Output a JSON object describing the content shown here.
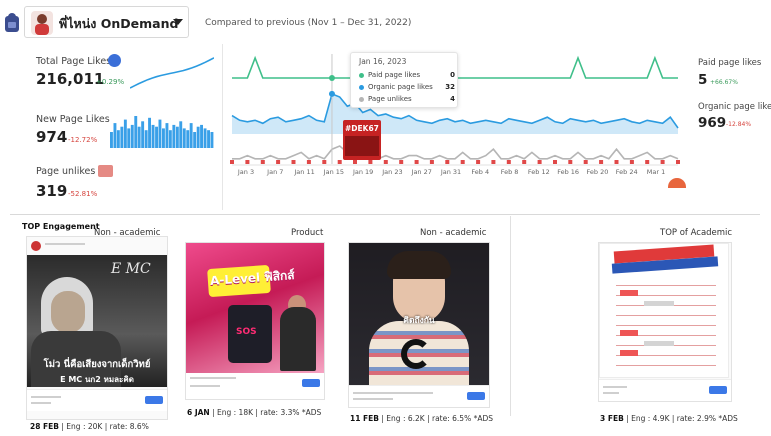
{
  "header": {
    "page_name": "พี่ไหน่ง OnDemand",
    "compare_text": "Compared to previous (Nov 1 – Dec 31, 2022)"
  },
  "kpis": {
    "total_page_likes": {
      "label": "Total Page Likes",
      "value": "216,011",
      "delta": "+0.29%"
    },
    "new_page_likes": {
      "label": "New Page Likes",
      "value": "974",
      "delta": "-12.72%"
    },
    "page_unlikes": {
      "label": "Page unlikes",
      "value": "319",
      "delta": "-52.81%"
    }
  },
  "right_kpis": {
    "paid_page_likes": {
      "label": "Paid page likes",
      "value": "5",
      "delta": "+66.67%"
    },
    "organic_page_likes": {
      "label": "Organic page likes",
      "value": "969",
      "delta": "-12.84%"
    }
  },
  "tooltip": {
    "date": "Jan 16, 2023",
    "rows": [
      {
        "label": "Paid page likes",
        "value": "0",
        "color": "#3fbf8a"
      },
      {
        "label": "Organic page likes",
        "value": "32",
        "color": "#2b9be0"
      },
      {
        "label": "Page unlikes",
        "value": "4",
        "color": "#b5b5b5"
      }
    ]
  },
  "red_badge_text": "#DEK67",
  "chart_data": {
    "type": "line",
    "x_tick_labels": [
      "Jan 3",
      "Jan 7",
      "Jan 11",
      "Jan 15",
      "Jan 19",
      "Jan 23",
      "Jan 27",
      "Jan 31",
      "Feb 4",
      "Feb 8",
      "Feb 12",
      "Feb 16",
      "Feb 20",
      "Feb 24",
      "Mar 1"
    ],
    "series": [
      {
        "name": "Paid page likes",
        "color": "#3fbf8a",
        "values": [
          0,
          0,
          0,
          1,
          0,
          0,
          0,
          0,
          0,
          0,
          0,
          0,
          0,
          0,
          0,
          0,
          0,
          0,
          0,
          0,
          0,
          0,
          0,
          0,
          0,
          0,
          0,
          0,
          0,
          0,
          0,
          0,
          0,
          0,
          0,
          0,
          0,
          0,
          0,
          0,
          0,
          0,
          0,
          0,
          0,
          1,
          0,
          0,
          0,
          0,
          0,
          0,
          0,
          0,
          0,
          1,
          0,
          0,
          0
        ]
      },
      {
        "name": "Organic page likes",
        "color": "#2b9be0",
        "values": [
          18,
          15,
          14,
          15,
          13,
          16,
          17,
          14,
          15,
          16,
          18,
          15,
          14,
          32,
          30,
          24,
          26,
          20,
          22,
          18,
          19,
          17,
          16,
          18,
          15,
          14,
          13,
          15,
          16,
          14,
          15,
          13,
          14,
          15,
          14,
          13,
          16,
          15,
          14,
          13,
          15,
          17,
          14,
          13,
          16,
          15,
          14,
          15,
          13,
          14,
          15,
          16,
          14,
          13,
          15,
          14,
          13,
          17,
          10
        ]
      },
      {
        "name": "Page unlikes",
        "color": "#b5b5b5",
        "values": [
          1,
          1,
          2,
          1,
          1,
          2,
          1,
          1,
          2,
          3,
          1,
          2,
          1,
          4,
          5,
          3,
          1,
          2,
          1,
          1,
          2,
          1,
          1,
          2,
          2,
          1,
          1,
          2,
          1,
          1,
          3,
          1,
          1,
          2,
          4,
          1,
          1,
          2,
          1,
          3,
          1,
          1,
          2,
          1,
          1,
          3,
          1,
          1,
          2,
          1,
          4,
          1,
          1,
          2,
          3,
          1,
          1,
          2,
          1
        ]
      }
    ],
    "sparklines": {
      "total_page_likes": [
        1,
        2,
        3,
        4,
        5,
        6,
        7,
        8,
        9,
        10,
        11,
        12,
        13,
        14,
        15,
        16,
        17,
        18,
        19,
        20
      ],
      "new_page_likes": [
        9,
        14,
        10,
        12,
        16,
        11,
        13,
        18,
        12,
        15,
        10,
        17,
        13,
        12,
        16,
        11,
        14,
        10,
        13,
        12,
        15,
        11,
        10,
        14,
        9,
        12,
        13,
        11,
        10,
        9
      ]
    }
  },
  "posts": [
    {
      "title": "TOP Engagement",
      "subtitle": "Non - academic",
      "board_text": "E MC",
      "caption_1": "โม่ว นี่คือเสียงจากเด็กวิทย์",
      "caption_2": "E MC นก2 หมละคิด",
      "date": "28 FEB",
      "stats": " | Eng : 20K | rate: 8.6%"
    },
    {
      "title": "Product",
      "banner": "A-Level ฟิสิกส์",
      "sos": "SOS",
      "date": "6 JAN",
      "stats": " | Eng : 18K | rate: 3.3% *ADS"
    },
    {
      "title": "Non - academic",
      "overlay": "คิดถึงกัน",
      "date": "11 FEB",
      "stats": " | Eng : 6.2K | rate: 6.5% *ADS"
    },
    {
      "title": "TOP of Academic",
      "date": "3 FEB",
      "stats": " | Eng : 4.9K | rate: 2.9% *ADS"
    }
  ]
}
